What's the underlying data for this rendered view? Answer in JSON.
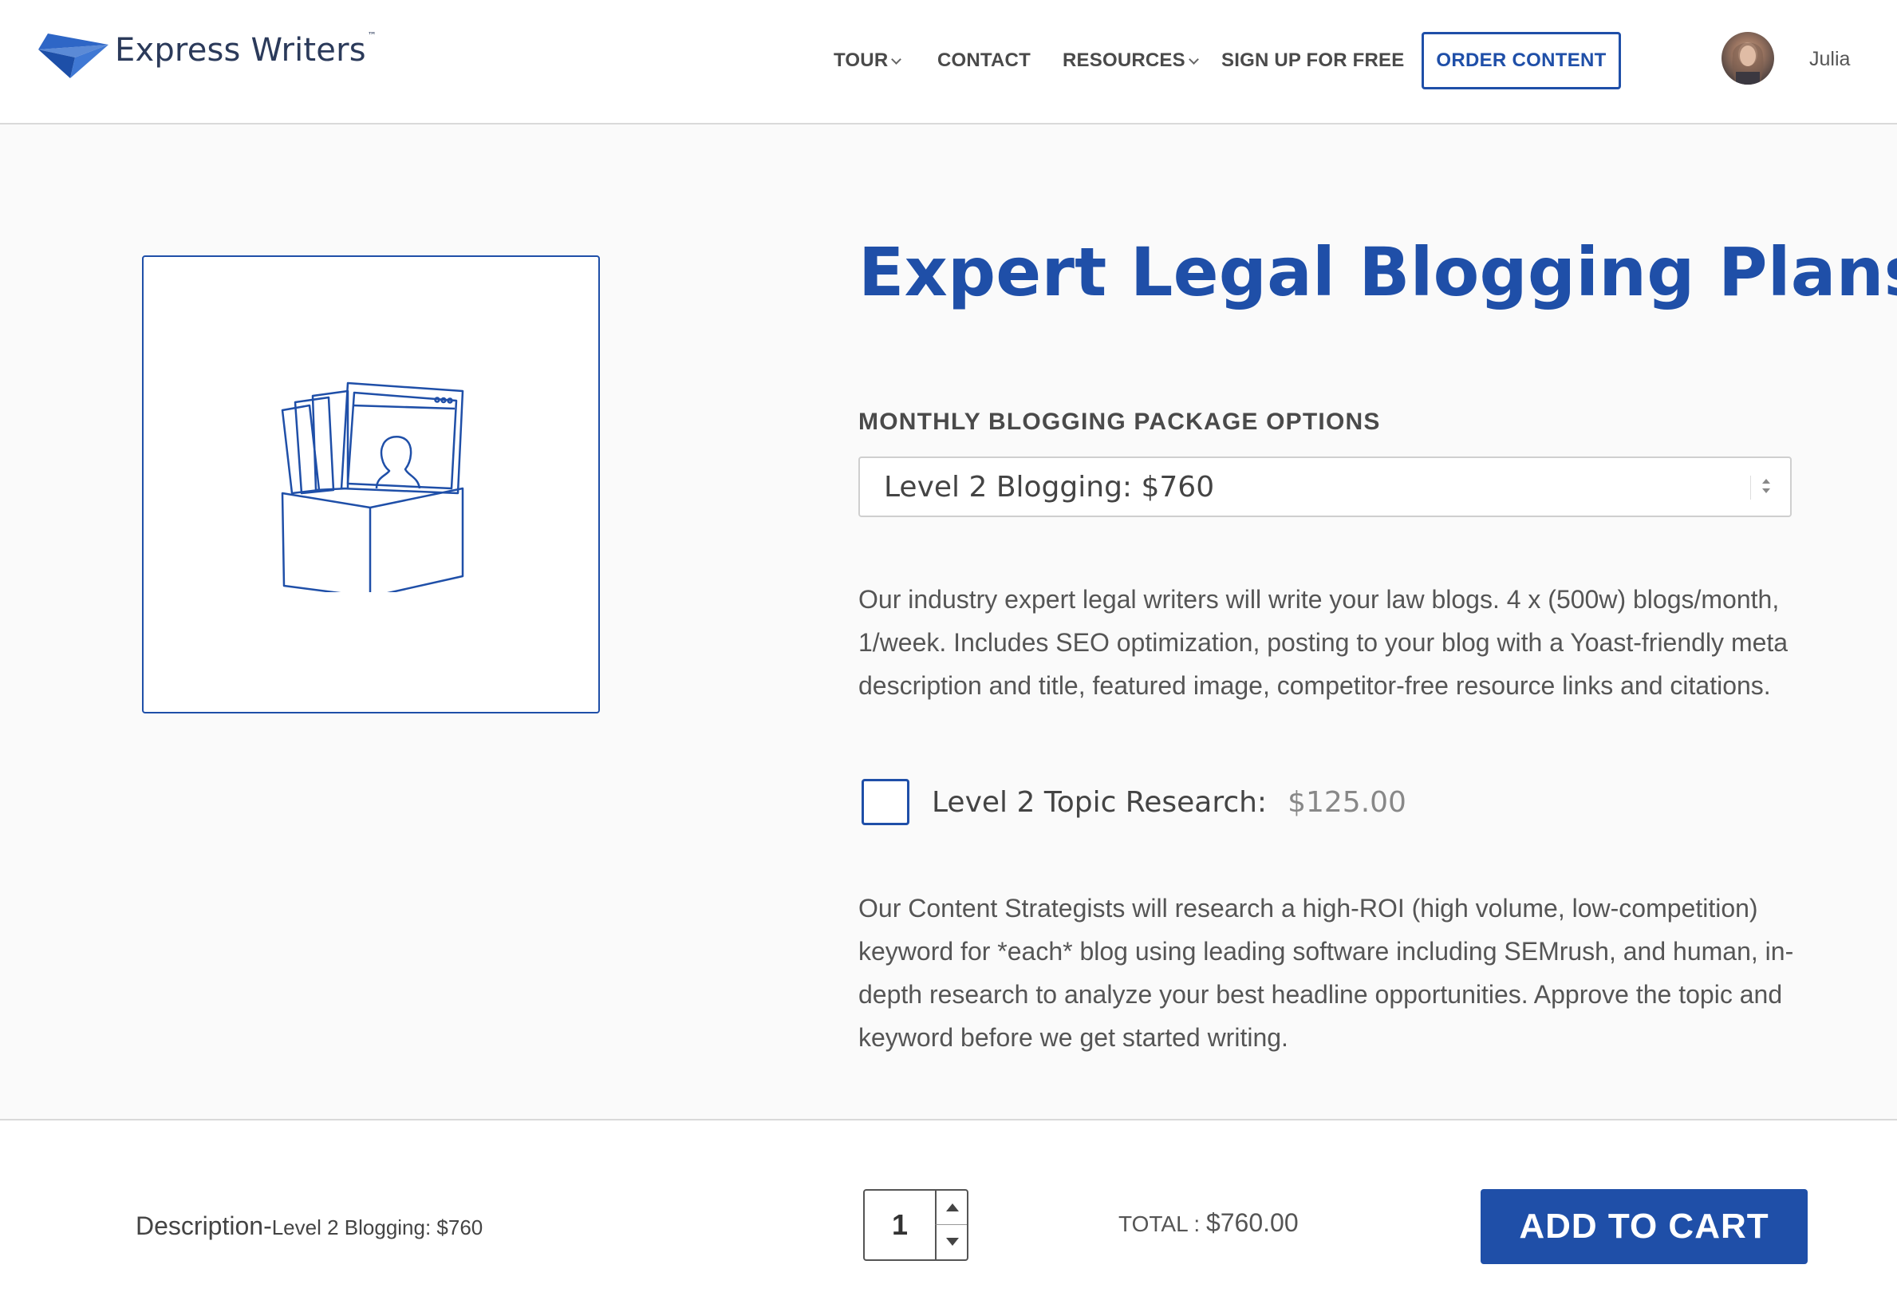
{
  "header": {
    "logo_text": "Express Writers",
    "logo_tm": "™",
    "nav": [
      {
        "label": "TOUR",
        "dropdown": true
      },
      {
        "label": "CONTACT",
        "dropdown": false
      },
      {
        "label": "RESOURCES",
        "dropdown": true
      },
      {
        "label": "SIGN UP FOR FREE",
        "dropdown": false
      }
    ],
    "order_button": "ORDER CONTENT",
    "user_name": "Julia"
  },
  "product": {
    "title": "Expert Legal Blogging Plans",
    "image_icon": "box-of-documents-icon",
    "options_label": "MONTHLY BLOGGING PACKAGE OPTIONS",
    "selected_option": "Level 2 Blogging: $760",
    "description": "Our industry expert legal writers will write your law blogs. 4 x (500w) blogs/month, 1/week. Includes SEO optimization, posting to your blog with a Yoast-friendly meta description and title, featured image, competitor-free resource links and citations.",
    "addon": {
      "label": "Level 2 Topic Research:",
      "price": "$125.00",
      "checked": false,
      "description": "Our Content Strategists will research a high-ROI (high volume, low-competition) keyword for *each* blog using leading software including SEMrush, and human, in-depth research to analyze your best headline opportunities. Approve the topic and keyword before we get started writing."
    }
  },
  "cart_bar": {
    "description_label": "Description-",
    "description_value": "Level 2 Blogging: $760",
    "quantity": "1",
    "total_label": "TOTAL : ",
    "total_value": "$760.00",
    "add_button": "ADD TO CART"
  },
  "colors": {
    "brand_blue": "#1f4fa8",
    "text_gray": "#555555"
  }
}
